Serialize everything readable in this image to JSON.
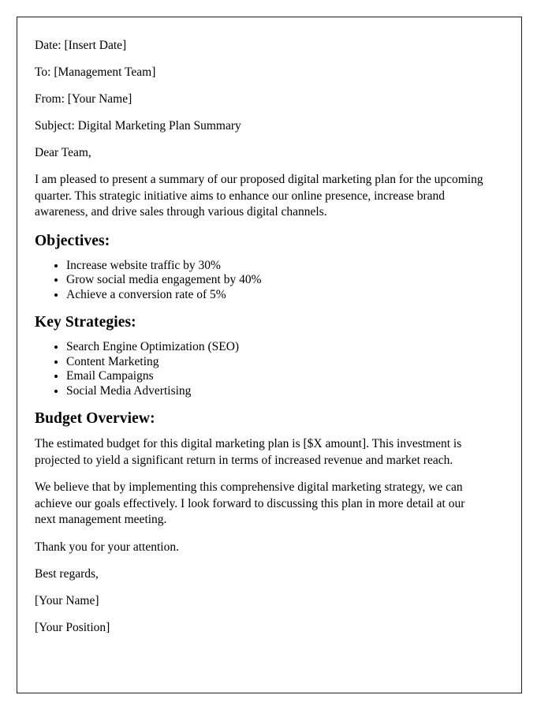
{
  "document": {
    "header_fields": [
      {
        "label": "Date:",
        "value": "[Insert Date]",
        "text": "Date: [Insert Date]"
      },
      {
        "label": "To:",
        "value": "[Management Team]",
        "text": "To: [Management Team]"
      },
      {
        "label": "From:",
        "value": "[Your Name]",
        "text": "From: [Your Name]"
      },
      {
        "label": "Subject:",
        "value": "Digital Marketing Plan Summary",
        "text": "Subject: Digital Marketing Plan Summary"
      }
    ],
    "salutation": "Dear Team,",
    "intro_paragraph": "I am pleased to present a summary of our proposed digital marketing plan for the upcoming quarter. This strategic initiative aims to enhance our online presence, increase brand awareness, and drive sales through various digital channels.",
    "sections": [
      {
        "heading": "Objectives:",
        "items": [
          "Increase website traffic by 30%",
          "Grow social media engagement by 40%",
          "Achieve a conversion rate of 5%"
        ]
      },
      {
        "heading": "Key Strategies:",
        "items": [
          "Search Engine Optimization (SEO)",
          "Content Marketing",
          "Email Campaigns",
          "Social Media Advertising"
        ]
      },
      {
        "heading": "Budget Overview:",
        "items": []
      }
    ],
    "budget_paragraph": "The estimated budget for this digital marketing plan is [$X amount]. This investment is projected to yield a significant return in terms of increased revenue and market reach.",
    "closing_paragraph": "We believe that by implementing this comprehensive digital marketing strategy, we can achieve our goals effectively. I look forward to discussing this plan in more detail at our next management meeting.",
    "thanks_line": "Thank you for your attention.",
    "signoff": "Best regards,",
    "signature_name": "[Your Name]",
    "signature_position": "[Your Position]"
  },
  "style": {
    "border_color": "#1d1d1f",
    "text_color": "#000000",
    "page_background": "#ffffff"
  }
}
